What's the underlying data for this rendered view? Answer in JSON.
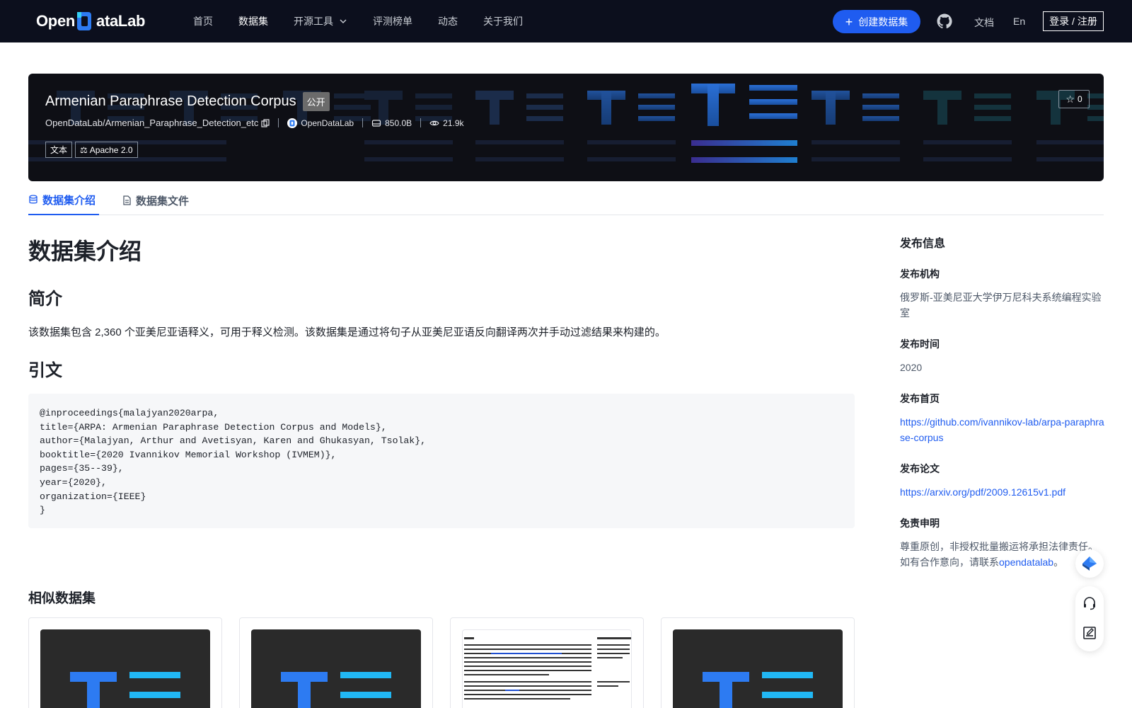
{
  "nav": {
    "logo_text_left": "Open",
    "logo_text_right": "ataLab",
    "links": [
      {
        "label": "首页"
      },
      {
        "label": "数据集"
      },
      {
        "label": "开源工具"
      },
      {
        "label": "评测榜单"
      },
      {
        "label": "动态"
      },
      {
        "label": "关于我们"
      }
    ],
    "create_label": "创建数据集",
    "docs_label": "文档",
    "lang_label": "En",
    "login_label": "登录 / 注册"
  },
  "banner": {
    "title": "Armenian Paraphrase Detection Corpus",
    "visibility": "公开",
    "repo": "OpenDataLab/Armenian_Paraphrase_Detection_etc",
    "publisher": "OpenDataLab",
    "size": "850.0B",
    "views": "21.9k",
    "tags": [
      "文本",
      "Apache 2.0"
    ],
    "stars": "0"
  },
  "tabs": [
    {
      "label": "数据集介绍"
    },
    {
      "label": "数据集文件"
    }
  ],
  "content": {
    "heading": "数据集介绍",
    "intro_heading": "简介",
    "intro_text": "该数据集包含 2,360 个亚美尼亚语释义，可用于释义检测。该数据集是通过将句子从亚美尼亚语反向翻译两次并手动过滤结果来构建的。",
    "cite_heading": "引文",
    "citation": "@inproceedings{malajyan2020arpa,\ntitle={ARPA: Armenian Paraphrase Detection Corpus and Models},\nauthor={Malajyan, Arthur and Avetisyan, Karen and Ghukasyan, Tsolak},\nbooktitle={2020 Ivannikov Memorial Workshop (IVMEM)},\npages={35--39},\nyear={2020},\norganization={IEEE}\n}",
    "similar_heading": "相似数据集"
  },
  "sidebar": {
    "heading": "发布信息",
    "org_label": "发布机构",
    "org_value": "俄罗斯-亚美尼亚大学伊万尼科夫系统编程实验室",
    "time_label": "发布时间",
    "time_value": "2020",
    "home_label": "发布首页",
    "home_value": "https://github.com/ivannikov-lab/arpa-paraphrase-corpus",
    "paper_label": "发布论文",
    "paper_value": "https://arxiv.org/pdf/2009.12615v1.pdf",
    "disclaimer_label": "免责申明",
    "disclaimer_text": "尊重原创，非授权批量搬运将承担法律责任。如有合作意向，请联系",
    "disclaimer_link": "opendatalab",
    "disclaimer_end": "。"
  },
  "colors": {
    "nav_bg": "#0c0f1d",
    "primary": "#1f5cf0",
    "banner_bg": "#0e0f15",
    "code_bg": "#f6f7f9"
  }
}
